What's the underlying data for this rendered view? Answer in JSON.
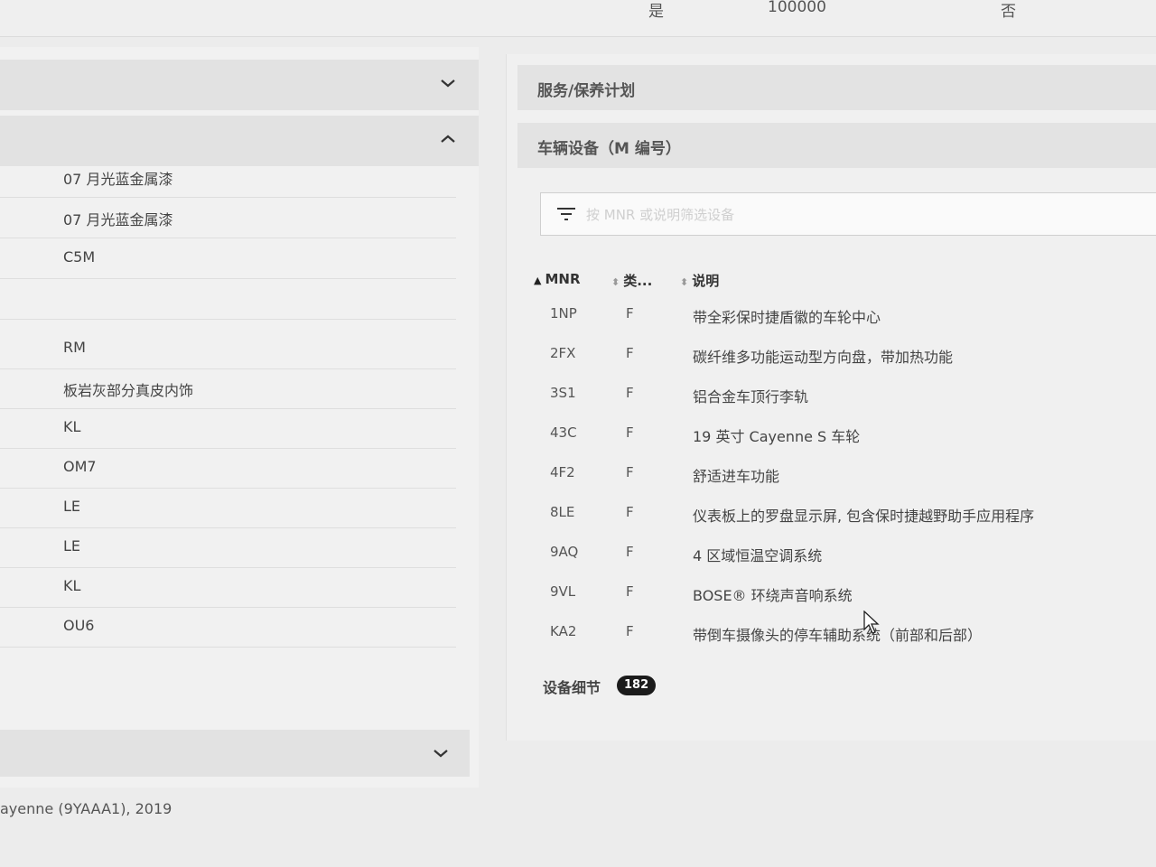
{
  "top_strip": {
    "col_a": "是",
    "col_b": "100000",
    "col_c": "否"
  },
  "right_accordions": {
    "service_plan": "服务/保养计划",
    "vehicle_equipment": "车辆设备（M 编号）"
  },
  "filter": {
    "placeholder": "按 MNR 或说明筛选设备"
  },
  "table": {
    "headers": {
      "mnr": "MNR",
      "type": "类...",
      "description": "说明"
    },
    "rows": [
      {
        "mnr": "1NP",
        "type": "F",
        "description": "带全彩保时捷盾徽的车轮中心"
      },
      {
        "mnr": "2FX",
        "type": "F",
        "description": "碳纤维多功能运动型方向盘，带加热功能"
      },
      {
        "mnr": "3S1",
        "type": "F",
        "description": "铝合金车顶行李轨"
      },
      {
        "mnr": "43C",
        "type": "F",
        "description": "19 英寸 Cayenne S 车轮"
      },
      {
        "mnr": "4F2",
        "type": "F",
        "description": "舒适进车功能"
      },
      {
        "mnr": "8LE",
        "type": "F",
        "description": "仪表板上的罗盘显示屏, 包含保时捷越野助手应用程序"
      },
      {
        "mnr": "9AQ",
        "type": "F",
        "description": "4 区域恒温空调系统"
      },
      {
        "mnr": "9VL",
        "type": "F",
        "description": "BOSE® 环绕声音响系统"
      },
      {
        "mnr": "KA2",
        "type": "F",
        "description": "带倒车摄像头的停车辅助系统（前部和后部）"
      }
    ]
  },
  "equipment_details": {
    "label": "设备细节",
    "count": "182"
  },
  "left_list": [
    "07 月光蓝金属漆",
    "07 月光蓝金属漆",
    "C5M",
    "",
    "RM",
    "板岩灰部分真皮内饰",
    "KL",
    "OM7",
    "LE",
    "LE",
    "KL",
    "OU6"
  ],
  "footer": {
    "model": "ayenne (9YAAA1), 2019"
  },
  "icons": {
    "chevron_down": "chevron-down-icon",
    "chevron_up": "chevron-up-icon",
    "filter": "filter-icon",
    "cursor": "mouse-cursor-icon"
  }
}
